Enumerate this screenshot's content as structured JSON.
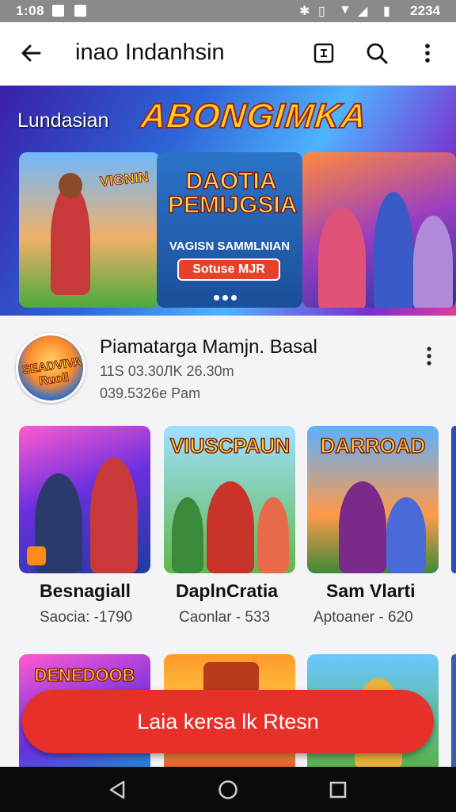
{
  "status_bar": {
    "time": "1:08",
    "right_text": "2234"
  },
  "app_bar": {
    "title": "inao Indanhsin"
  },
  "banner": {
    "label": "Lundasian",
    "logo_text": "ABONGIMKA",
    "card1_tag": "VIGNIN",
    "card2_title": "DAOTIA PEMIJGSIA",
    "card2_subtitle": "VAGISN SAMMLNIAN",
    "card2_button": "Sotuse MJR",
    "carousel_pages": 3
  },
  "featured": {
    "avatar_text": "SEADVIVA Ruoll",
    "name": "Piamatarga Mamjn. Basal",
    "line1": "11S 03.30ЛK 26.30m",
    "line2": "039.5326e Pam"
  },
  "tiles": [
    {
      "art_title": "",
      "name": "Besnagiall",
      "sub": "Saocia: -1790"
    },
    {
      "art_title": "VIUSCPAUN",
      "name": "DaplnCratia",
      "sub": "Caonlar - 533"
    },
    {
      "art_title": "DARROAD",
      "name": "Sam Vlarti",
      "sub": "Aptoaner - 620"
    }
  ],
  "row2_tiles": [
    {
      "art_title": "DENEDOOB"
    },
    {
      "art_title": ""
    },
    {
      "art_title": ""
    }
  ],
  "cta": {
    "label": "Laia kersa lk Rtesn"
  },
  "colors": {
    "accent": "#e8302a",
    "appbar_bg": "#ffffff",
    "status_bg": "#8a8a8e",
    "nav_bg": "#0b0b0b"
  }
}
